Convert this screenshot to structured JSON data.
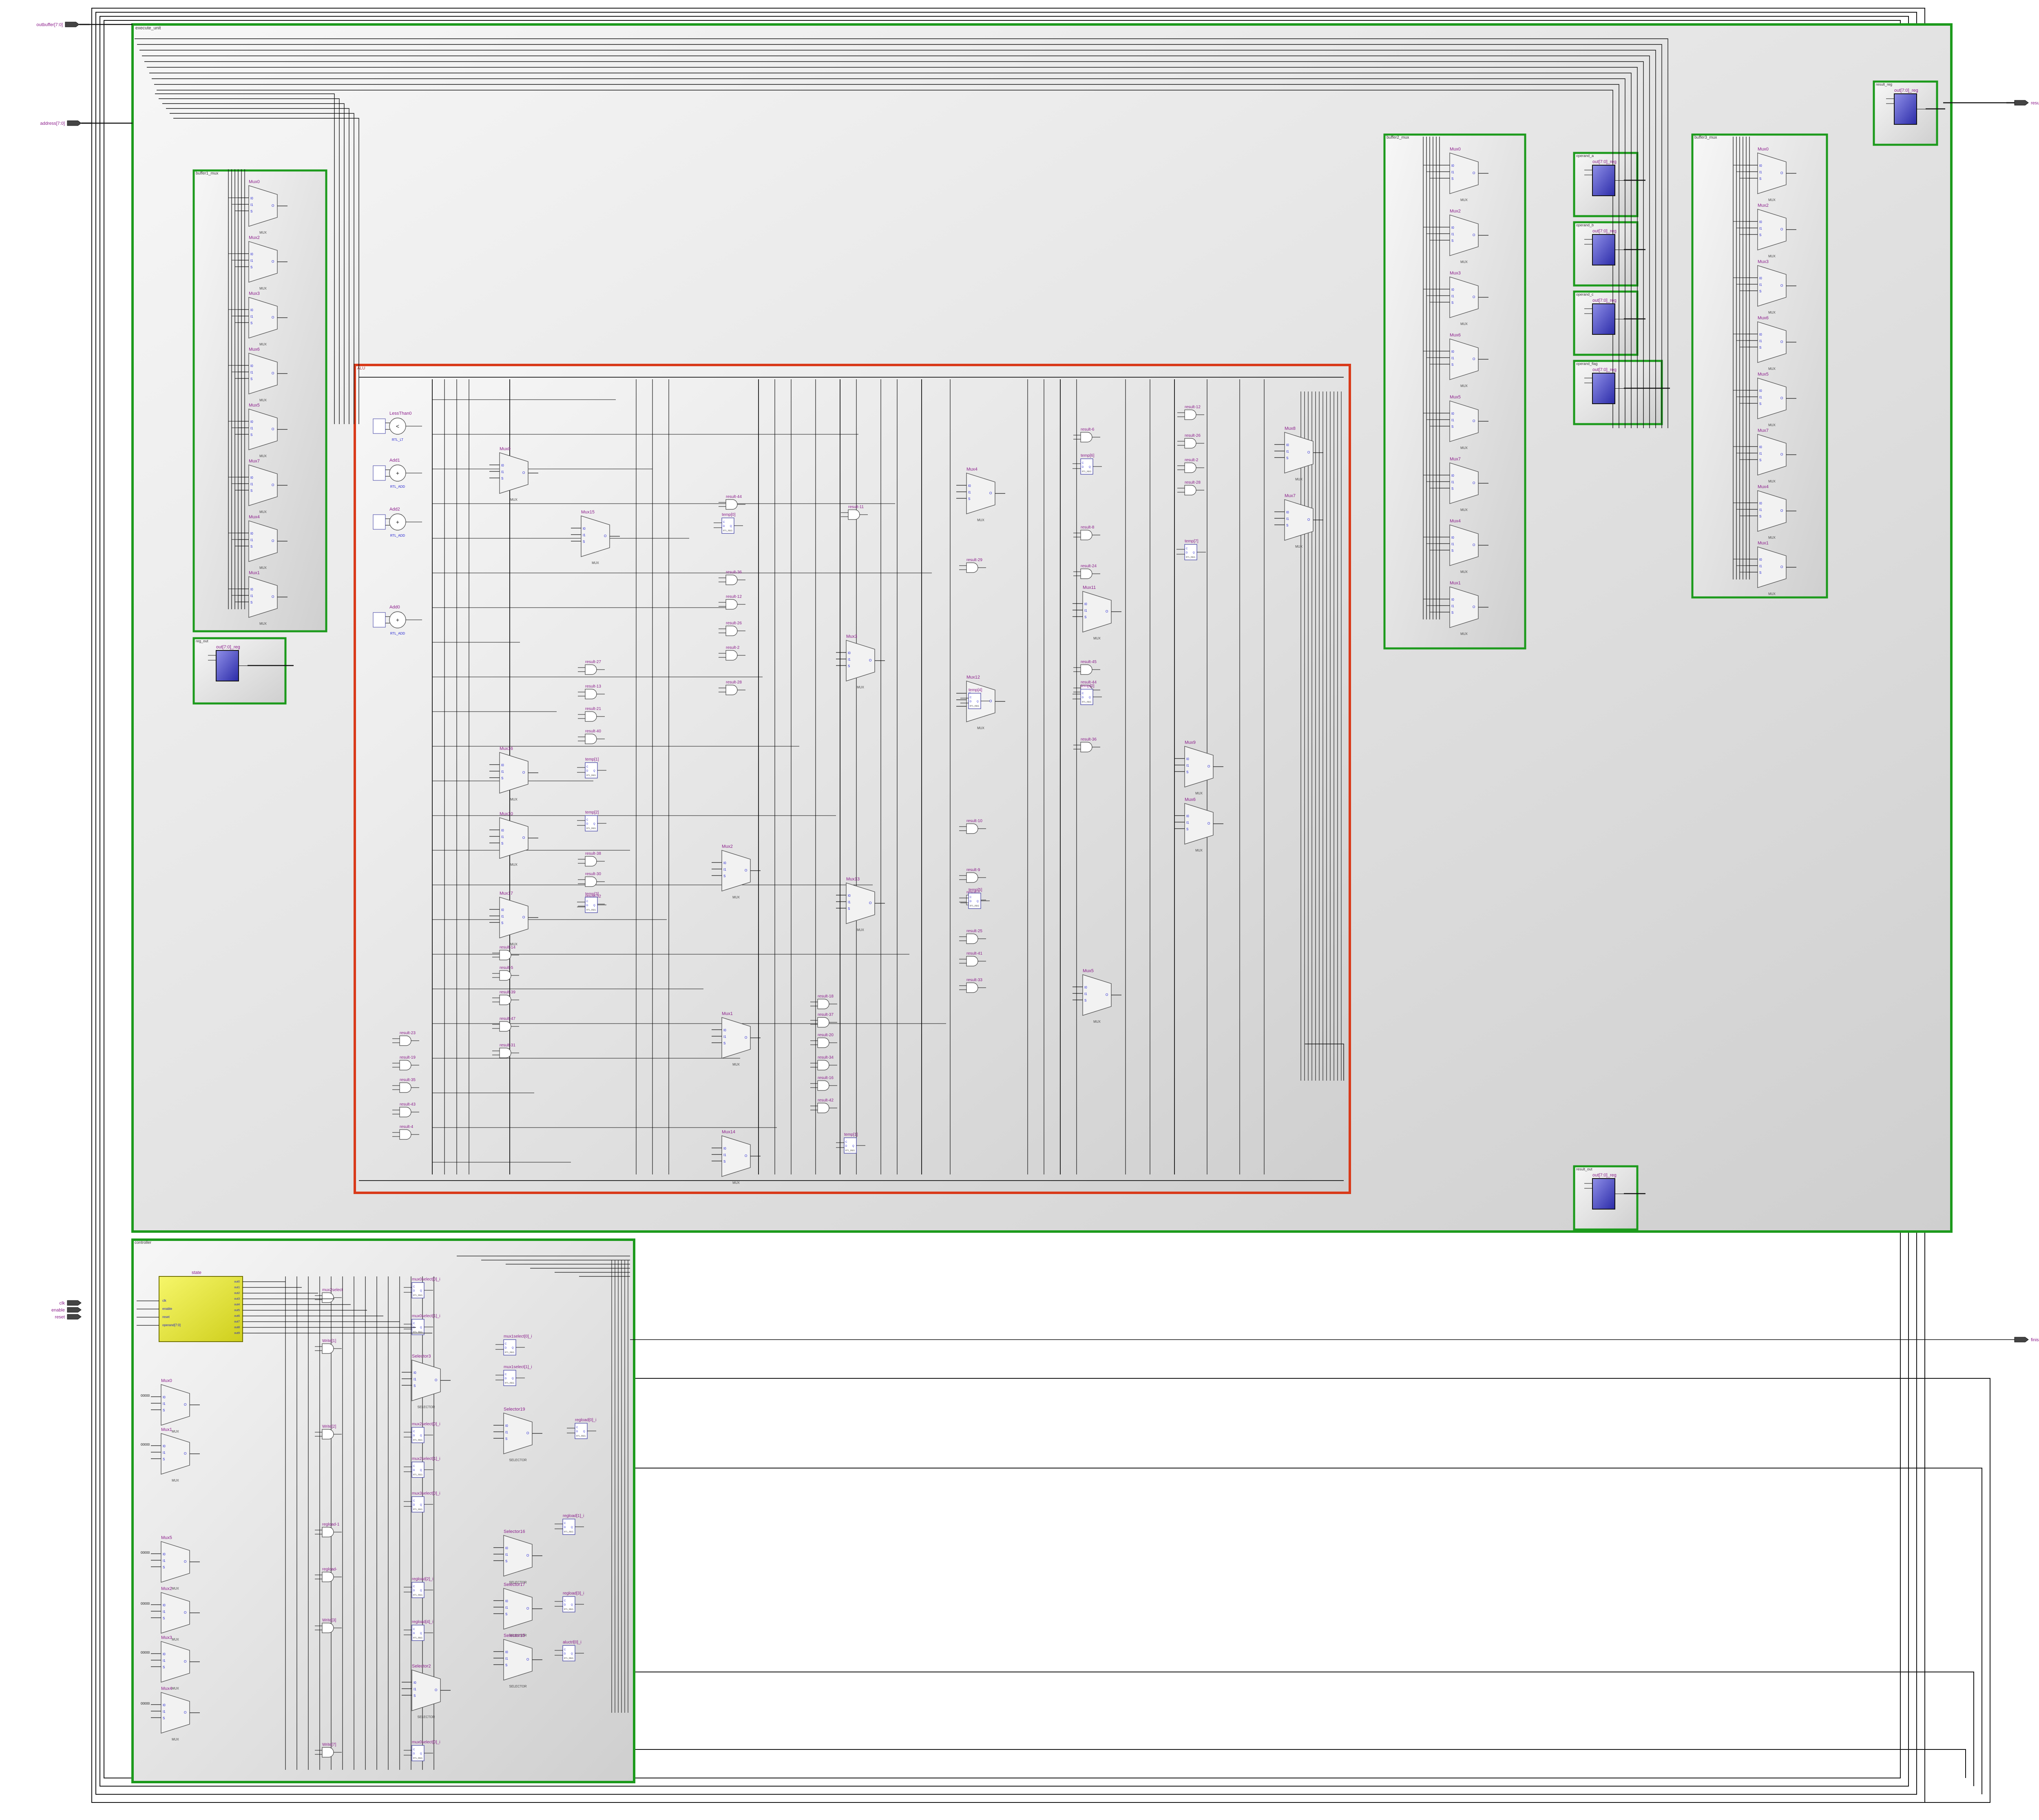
{
  "ports": {
    "in": [
      {
        "id": "p_outbuf",
        "label": "outbuffer[7:0]",
        "bus": true
      },
      {
        "id": "p_address",
        "label": "address[7:0]",
        "bus": true
      },
      {
        "id": "p_clk",
        "label": "clk",
        "bus": false
      },
      {
        "id": "p_enable",
        "label": "enable",
        "bus": false
      },
      {
        "id": "p_reset",
        "label": "reset",
        "bus": false
      }
    ],
    "out": [
      {
        "id": "p_result",
        "label": "result[7:0]",
        "bus": true
      },
      {
        "id": "p_finished",
        "label": "finished",
        "bus": false
      }
    ]
  },
  "modules": {
    "top_alu": "execute_unit",
    "alu_core": "ALU",
    "control": "controller",
    "control_fsm": "state",
    "bus_left": "buffer1_mux",
    "bus_mid": "buffer2_mux",
    "bus_right": "buffer3_mux",
    "reg_rlo": "reg_out",
    "reg_top": "result_reg",
    "reg_a": "operand_a",
    "reg_b": "operand_b",
    "reg_c": "operand_c",
    "reg_d": "operand_flag",
    "reg_bottom": "result_out"
  },
  "cell_types": {
    "mux": "MUX",
    "selector": "SELECTOR",
    "reg": "RTL_REG",
    "add": "RTL_ADD",
    "cmp": "RTL_LT",
    "and": "RTL_AND"
  },
  "pins": {
    "s": "S",
    "i0": "I0",
    "i1": "I1",
    "o": "O",
    "c": "C",
    "d": "D",
    "q": "Q",
    "ce": "CE",
    "clr": "CLR",
    "sel": "S[1:0]"
  },
  "reg_cell_label": "out[7:0]_reg",
  "fsm": {
    "title": "state",
    "inputs": [
      "clk",
      "enable",
      "reset",
      "operand[7:0]"
    ],
    "outputs": [
      "out0",
      "out1",
      "out2",
      "out3",
      "out4",
      "out5",
      "out6",
      "out7",
      "out8",
      "out9"
    ]
  },
  "alu": {
    "cmp": [
      "LessThan0"
    ],
    "add": [
      "Add1",
      "Add2",
      "Add0"
    ],
    "mux": [
      "Mux0",
      "Mux15",
      "Mux16",
      "Mux10",
      "Mux17",
      "Mux2",
      "Mux1",
      "Mux14",
      "Mux4",
      "Mux3",
      "Mux12",
      "Mux13",
      "Mux8",
      "Mux11",
      "Mux9",
      "Mux6",
      "Mux7",
      "Mux5",
      "Mux10"
    ],
    "gates": [
      "result-44",
      "result-36",
      "result-12",
      "result-26",
      "result-2",
      "result-28",
      "result-27",
      "result-13",
      "result-21",
      "result-40",
      "result-38",
      "result-30",
      "result-32",
      "result-14",
      "result-5",
      "result-39",
      "result-47",
      "result-31",
      "result-23",
      "result-19",
      "result-35",
      "result-43",
      "result-4",
      "result-11",
      "result-18",
      "result-37",
      "result-20",
      "result-34",
      "result-16",
      "result-42",
      "result-29",
      "result-10",
      "result-9",
      "result-7",
      "result-25",
      "result-41",
      "result-33",
      "result-6",
      "result-8",
      "result-24",
      "result-45"
    ],
    "regs": [
      "temp[0]",
      "temp[1]",
      "temp[2]",
      "temp[3]",
      "temp[4]",
      "temp[5]",
      "temp[6]",
      "temp[7]"
    ]
  },
  "control_cells": {
    "mux": [
      "Mux0",
      "Mux1",
      "Mux5",
      "Mux2",
      "Mux3",
      "Mux4"
    ],
    "selectors": [
      "Selector3",
      "Selector19",
      "Selector16",
      "Selector17",
      "Selector15",
      "Selector2"
    ],
    "regs": [
      "mux0select[0]_i",
      "mux0select[1]_i",
      "mux1select[0]_i",
      "mux1select[1]_i",
      "mux2select[0]_i",
      "mux2select[1]_i",
      "mux3select[0]_i",
      "regload[0]_i",
      "regload[1]_i",
      "regload[2]_i",
      "regload[3]_i",
      "regload[4]_i",
      "aluctrl[0]_i"
    ],
    "gates": [
      "mux2select",
      "Write[1]",
      "Write[2]",
      "regload-1",
      "regload-",
      "Write[3]",
      "Write[7]"
    ]
  },
  "bus_mux_labels": [
    "Mux0",
    "Mux2",
    "Mux3",
    "Mux6",
    "Mux5",
    "Mux7",
    "Mux4",
    "Mux1"
  ],
  "const_labels": [
    "00000",
    "V=0",
    "V=B'0"
  ]
}
